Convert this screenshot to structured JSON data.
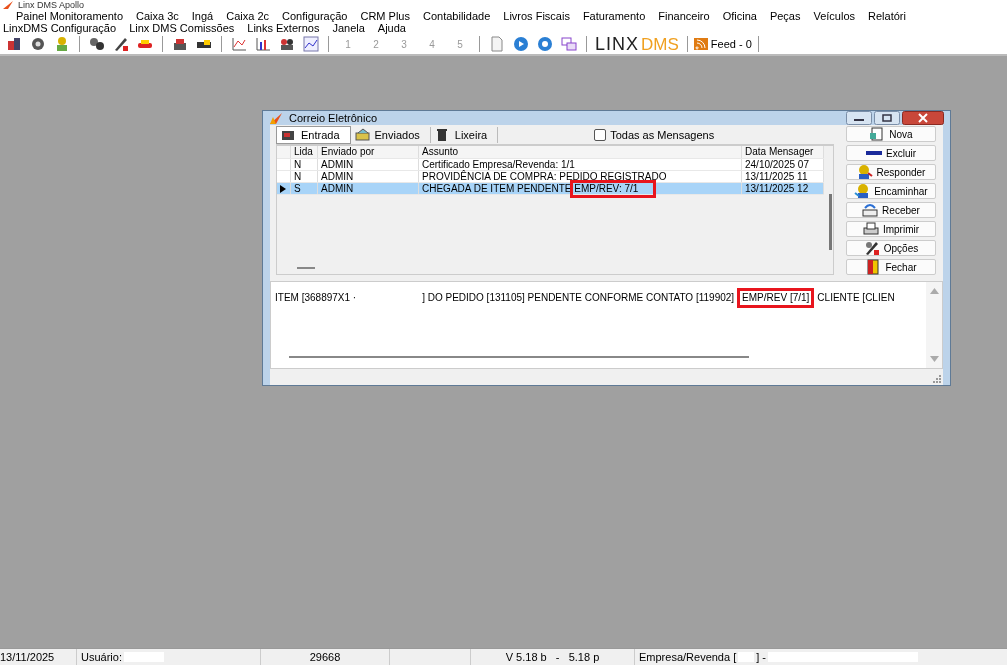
{
  "app": {
    "title": "Linx DMS Apollo"
  },
  "menu_rows": [
    [
      "Painel Monitoramento",
      "Caixa 3c",
      "Ingá",
      "Caixa 2c",
      "Configuração",
      "CRM Plus",
      "Contabilidade",
      "Livros Fiscais",
      "Faturamento",
      "Financeiro",
      "Oficina",
      "Peças",
      "Veículos",
      "Relatóri"
    ],
    [
      "LinxDMS Configuração",
      "Linx DMS Comissões",
      "Links Externos",
      "Janela",
      "Ajuda"
    ]
  ],
  "toolbar": {
    "numbers": [
      "1",
      "2",
      "3",
      "4",
      "5"
    ],
    "logo_main": "LINX",
    "logo_sub": "DMS",
    "feed": "Feed - 0"
  },
  "dialog": {
    "title": "Correio Eletrônico",
    "tabs": [
      {
        "label": "Entrada",
        "selected": true
      },
      {
        "label": "Enviados",
        "selected": false
      },
      {
        "label": "Lixeira",
        "selected": false
      }
    ],
    "all_messages": {
      "label": "Todas as Mensagens",
      "checked": false
    },
    "columns": [
      "Lida",
      "Enviado por",
      "Assunto",
      "Data Mensager"
    ],
    "rows": [
      {
        "cells": [
          "N",
          "ADMIN",
          "Certificado Empresa/Revenda: 1/1",
          "24/10/2025 07"
        ],
        "selected": false
      },
      {
        "cells": [
          "N",
          "ADMIN",
          "PROVIDÊNCIA DE COMPRA: PEDIDO REGISTRADO",
          "13/11/2025 11"
        ],
        "selected": false
      },
      {
        "cells": [
          "S",
          "ADMIN",
          "CHEGADA DE ITEM PENDENTE EMP/REV: 7/1",
          "13/11/2025 12"
        ],
        "selected": true
      }
    ],
    "buttons": [
      {
        "label": "Nova",
        "kind": "new"
      },
      {
        "label": "Excluir",
        "kind": "delete"
      },
      {
        "label": "Responder",
        "kind": "reply"
      },
      {
        "label": "Encaminhar",
        "kind": "forward"
      },
      {
        "label": "Receber",
        "kind": "receive"
      },
      {
        "label": "Imprimir",
        "kind": "print"
      },
      {
        "label": "Opções",
        "kind": "options"
      },
      {
        "label": "Fechar",
        "kind": "close"
      }
    ],
    "message": {
      "before": "ITEM [368897X1 ·",
      "after": "] DO PEDIDO [131105] PENDENTE CONFORME CONTATO [119902]",
      "highlighted": "EMP/REV [7/1]",
      "rest": "CLIENTE [CLIEN"
    }
  },
  "status_bar": {
    "date": "13/11/2025",
    "user_label": "Usuário:",
    "code": "29668",
    "version": "V 5.18 b   -   5.18 p",
    "company_label": "Empresa/Revenda [",
    "company_sep": "] -"
  }
}
